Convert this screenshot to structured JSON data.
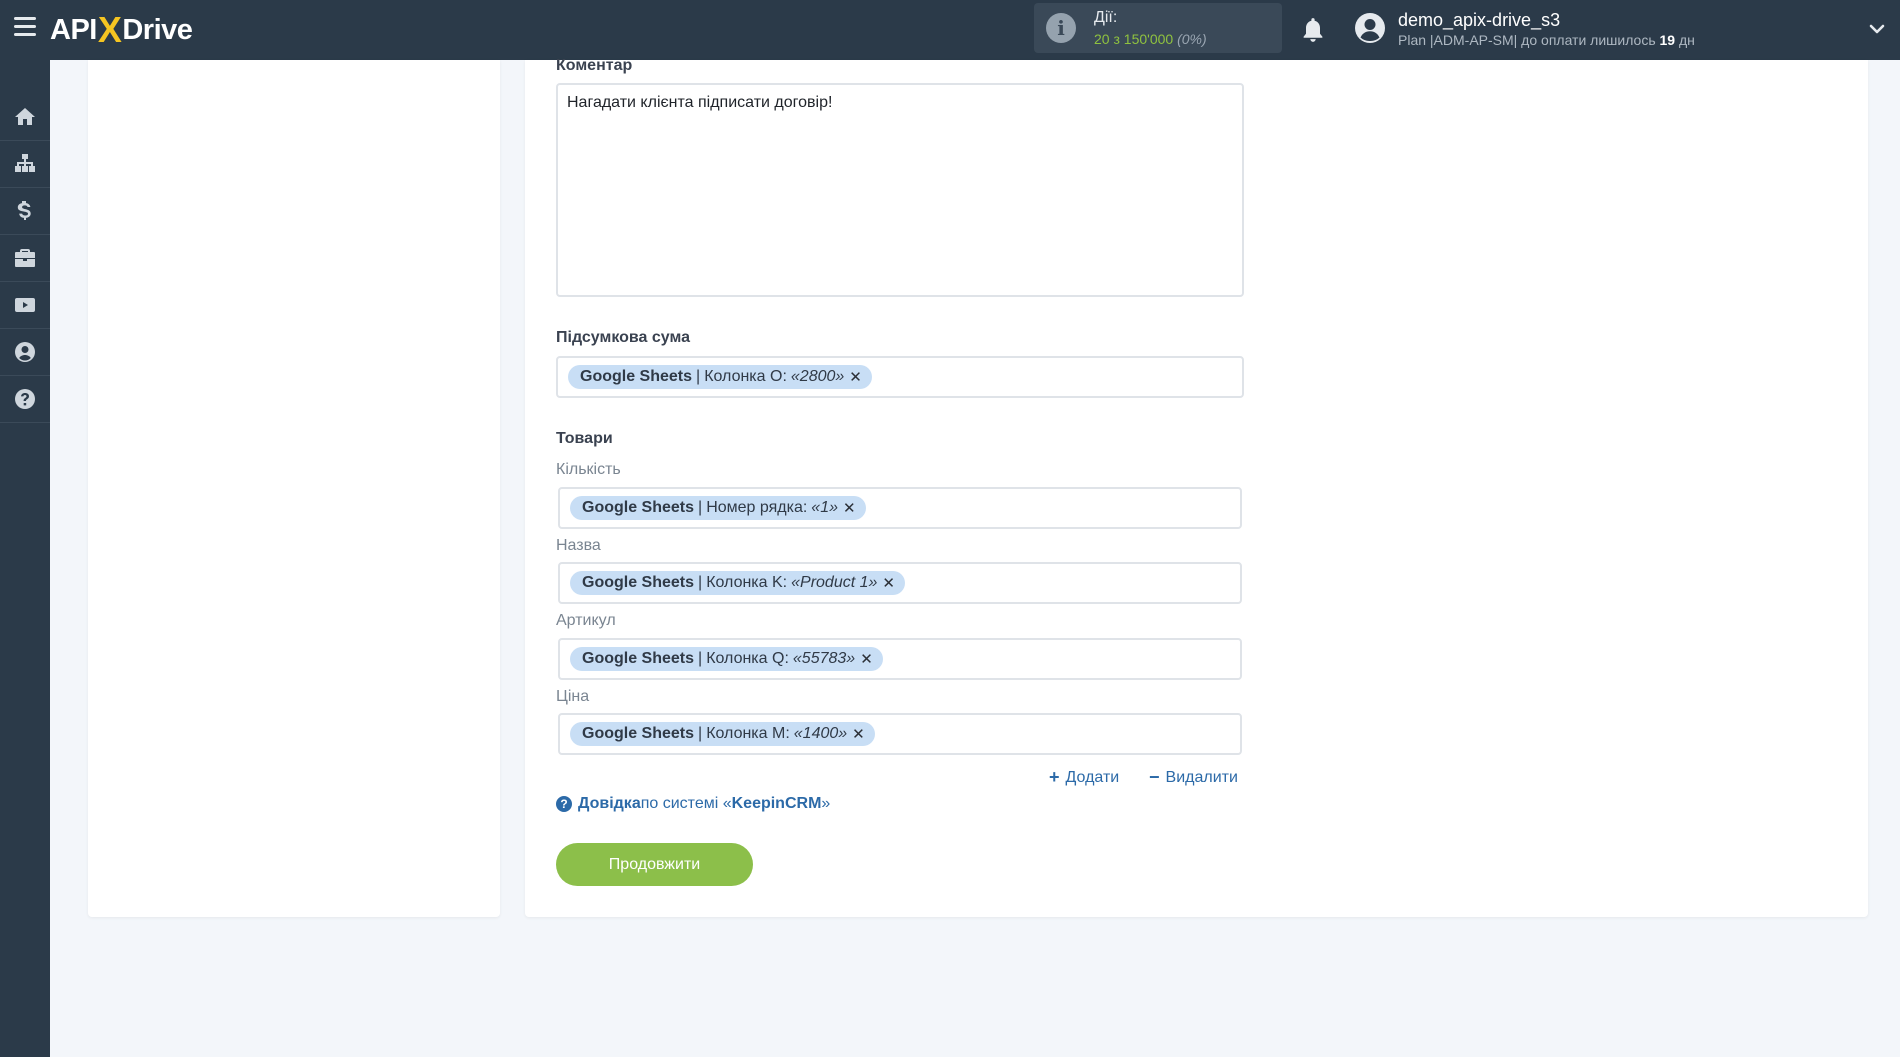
{
  "header": {
    "logo": {
      "part1": "API",
      "x": "X",
      "part2": "Drive"
    },
    "actions": {
      "label": "Дії:",
      "used": "20",
      "separator": " з ",
      "limit": "150'000",
      "percent": "(0%)"
    },
    "user": {
      "name": "demo_apix-drive_s3",
      "plan_prefix": "Plan |ADM-AP-SM| до оплати лишилось ",
      "days": "19",
      "days_suffix": " дн"
    }
  },
  "sidebar": {
    "items": [
      {
        "icon": "home-icon"
      },
      {
        "icon": "sitemap-icon"
      },
      {
        "icon": "dollar-icon"
      },
      {
        "icon": "briefcase-icon"
      },
      {
        "icon": "youtube-icon"
      },
      {
        "icon": "user-icon"
      },
      {
        "icon": "help-icon"
      }
    ]
  },
  "form": {
    "comment": {
      "label": "Коментар",
      "value": "Нагадати клієнта підписати договір!"
    },
    "total": {
      "label": "Підсумкова сума",
      "chip": {
        "source": "Google Sheets",
        "sep": "|",
        "field": "Колонка O:",
        "value": "«2800»"
      }
    },
    "goods": {
      "label": "Товари",
      "quantity": {
        "label": "Кількість",
        "chip": {
          "source": "Google Sheets",
          "sep": "|",
          "field": "Номер рядка:",
          "value": "«1»"
        }
      },
      "name": {
        "label": "Назва",
        "chip": {
          "source": "Google Sheets",
          "sep": "|",
          "field": "Колонка K:",
          "value": "«Product 1»"
        }
      },
      "sku": {
        "label": "Артикул",
        "chip": {
          "source": "Google Sheets",
          "sep": "|",
          "field": "Колонка Q:",
          "value": "«55783»"
        }
      },
      "price": {
        "label": "Ціна",
        "chip": {
          "source": "Google Sheets",
          "sep": "|",
          "field": "Колонка M:",
          "value": "«1400»"
        }
      },
      "add_label": "Додати",
      "remove_label": "Видалити"
    },
    "help": {
      "prefix": "Довідка",
      "middle": " по системі «",
      "system": "KeepinCRM",
      "suffix": "»"
    },
    "continue_label": "Продовжити"
  },
  "colors": {
    "topbar": "#2b3a49",
    "accent_green": "#8cbf4a",
    "chip_bg": "#c8def5",
    "link": "#2c6aa8",
    "logo_x": "#f6c521"
  }
}
